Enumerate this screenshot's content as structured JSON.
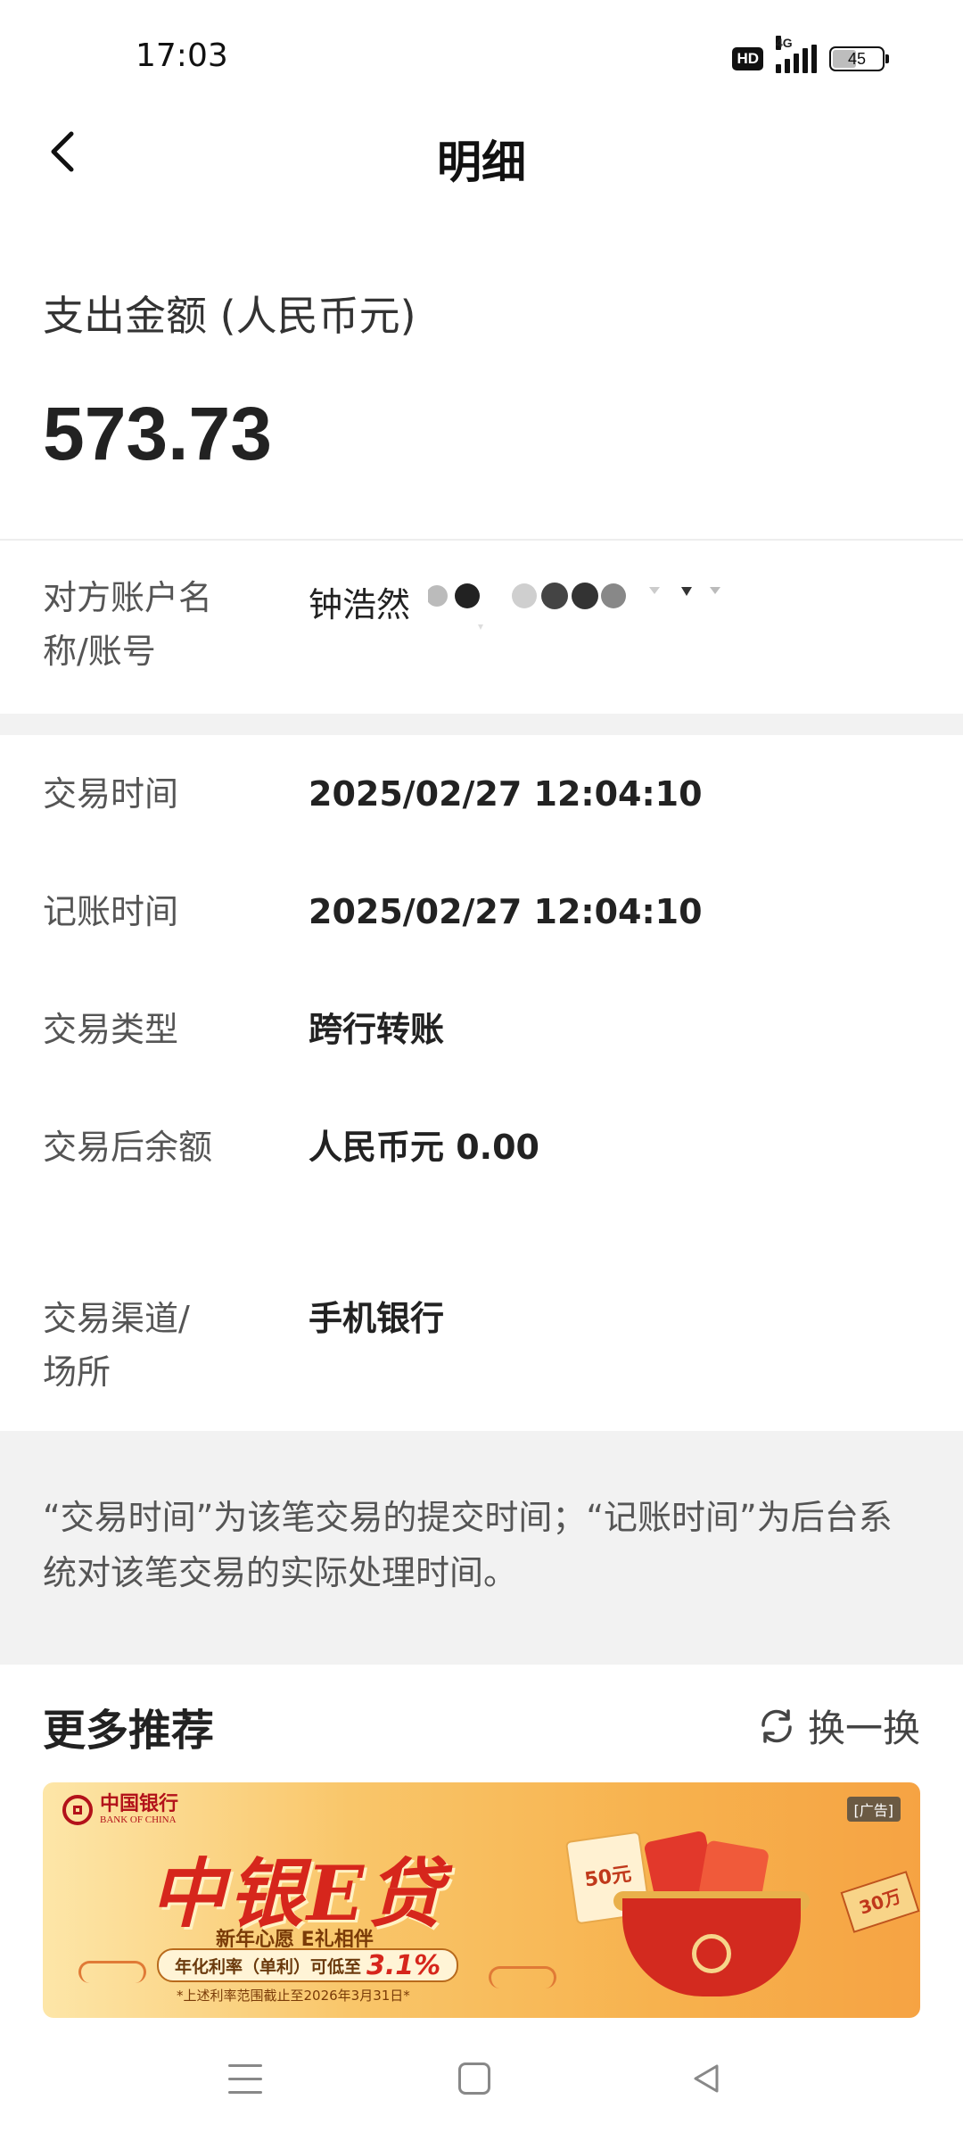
{
  "status_bar": {
    "time": "17:03",
    "hd": "HD",
    "network": "4G",
    "battery": "45",
    "battery_level": 0.45
  },
  "nav": {
    "title": "明细",
    "back_icon": "chevron-left-icon"
  },
  "summary": {
    "amount_label": "支出金额 (人民币元)",
    "amount": "573.73"
  },
  "counterparty": {
    "label": "对方账户名称/账号",
    "name": "钟浩然"
  },
  "details": [
    {
      "label": "交易时间",
      "value": "2025/02/27 12:04:10"
    },
    {
      "label": "记账时间",
      "value": "2025/02/27 12:04:10"
    },
    {
      "label": "交易类型",
      "value": "跨行转账"
    },
    {
      "label": "交易后余额",
      "value": "人民币元 0.00"
    },
    {
      "label": "交易渠道/场所",
      "value": "手机银行"
    }
  ],
  "note": {
    "text": "“交易时间”为该笔交易的提交时间；“记账时间”为后台系统对该笔交易的实际处理时间。"
  },
  "recommend": {
    "title": "更多推荐",
    "refresh_label": "换一换",
    "banner": {
      "bank_name": "中国银行",
      "bank_name_en": "BANK OF CHINA",
      "ad_tag": "[广告]",
      "brand": "中银E贷",
      "tagline": "新年心愿  E礼相伴",
      "rate_prefix": "年化利率（单利）可低至",
      "rate_value": "3.1%",
      "fine_print": "*上述利率范围截止至2026年3月31日*",
      "coupon": "50元",
      "stamp": "30万"
    }
  },
  "colors": {
    "accent_red": "#d6261c",
    "band_gray": "#f2f2f2",
    "text_dark": "#222222",
    "text_muted": "#555555"
  }
}
